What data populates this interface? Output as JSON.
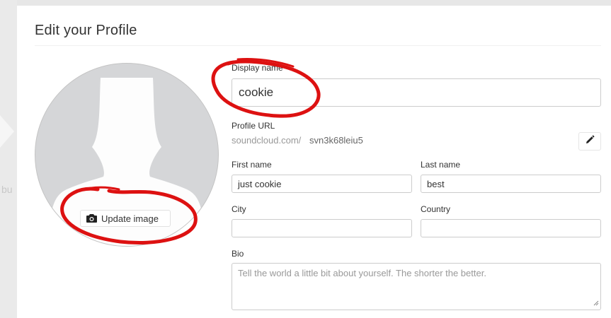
{
  "background": {
    "partial_text": "bu"
  },
  "modal": {
    "title": "Edit your Profile"
  },
  "avatar": {
    "update_button_label": "Update image",
    "button_icon": "camera-icon"
  },
  "display_name": {
    "label": "Display name",
    "required_marker": "*",
    "value": "cookie"
  },
  "profile_url": {
    "label": "Profile URL",
    "prefix": "soundcloud.com/",
    "value": "svn3k68leiu5",
    "edit_icon": "pencil-icon"
  },
  "first_name": {
    "label": "First name",
    "value": "just cookie"
  },
  "last_name": {
    "label": "Last name",
    "value": "best"
  },
  "city": {
    "label": "City",
    "value": ""
  },
  "country": {
    "label": "Country",
    "value": ""
  },
  "bio": {
    "label": "Bio",
    "placeholder": "Tell the world a little bit about yourself. The shorter the better."
  },
  "colors": {
    "annotation_red": "#dd1111",
    "required_orange": "#ff5500"
  }
}
